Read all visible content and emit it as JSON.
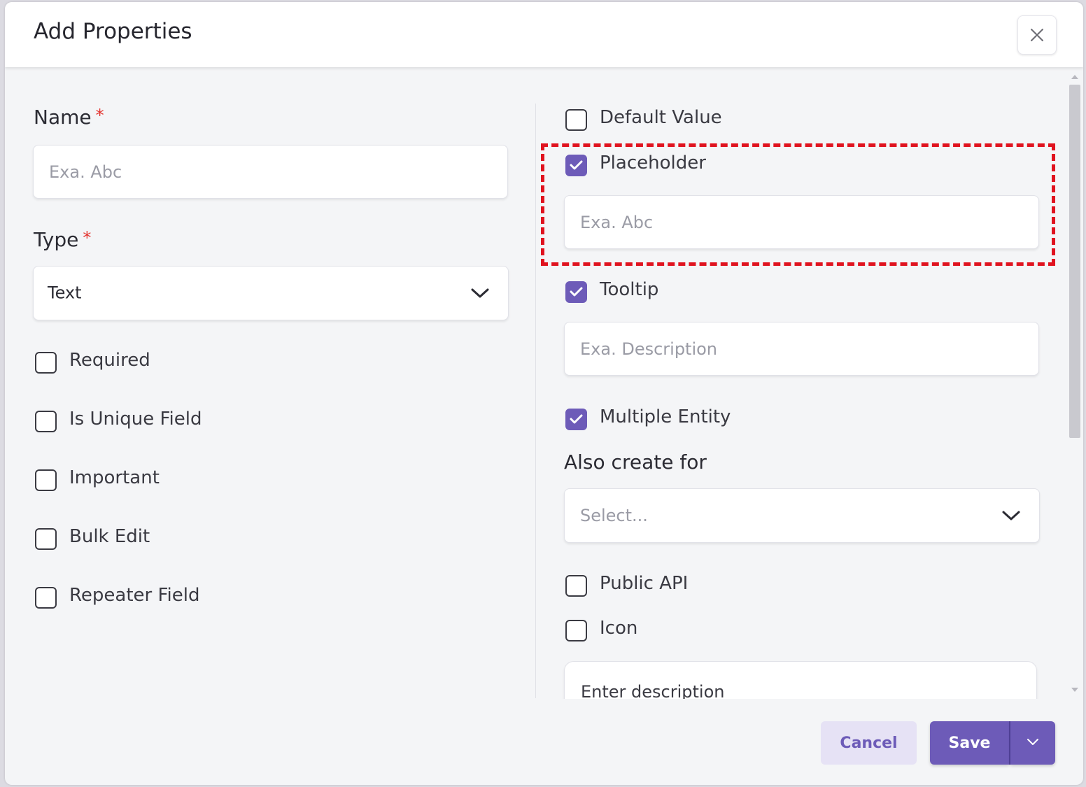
{
  "dialog": {
    "title": "Add Properties"
  },
  "name_field": {
    "label": "Name",
    "required_mark": "*",
    "placeholder": "Exa. Abc"
  },
  "type_field": {
    "label": "Type",
    "required_mark": "*",
    "value": "Text"
  },
  "left_checkboxes": [
    {
      "label": "Required",
      "checked": false
    },
    {
      "label": "Is Unique Field",
      "checked": false
    },
    {
      "label": "Important",
      "checked": false
    },
    {
      "label": "Bulk Edit",
      "checked": false
    },
    {
      "label": "Repeater Field",
      "checked": false
    }
  ],
  "right": {
    "default_value": {
      "label": "Default Value",
      "checked": false
    },
    "placeholder": {
      "label": "Placeholder",
      "checked": true,
      "input_placeholder": "Exa. Abc"
    },
    "tooltip": {
      "label": "Tooltip",
      "checked": true,
      "input_placeholder": "Exa. Description"
    },
    "multiple_entity": {
      "label": "Multiple Entity",
      "checked": true
    },
    "also_create_for": {
      "label": "Also create for",
      "placeholder": "Select..."
    },
    "public_api": {
      "label": "Public API",
      "checked": false
    },
    "icon": {
      "label": "Icon",
      "checked": false
    },
    "description": {
      "placeholder": "Enter description"
    }
  },
  "footer": {
    "cancel_label": "Cancel",
    "save_label": "Save"
  },
  "colors": {
    "accent": "#6d5bb8",
    "highlight": "#e0131f",
    "required": "#e3342f"
  }
}
